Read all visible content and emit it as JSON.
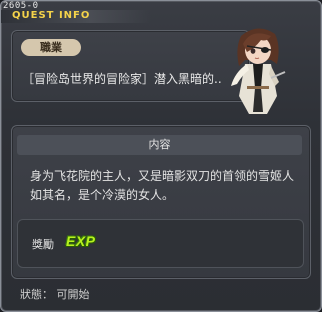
{
  "window": {
    "quest_id": "2605-0",
    "title": "QUEST INFO"
  },
  "job": {
    "tag": "職業",
    "description": "［冒险岛世界的冒险家］潜入黑暗的.."
  },
  "content": {
    "header": "内容",
    "text": "身为飞花院的主人，又是暗影双刀的首领的雪姬人如其名，是个冷漠的女人。"
  },
  "reward": {
    "label": "獎勵",
    "exp_icon_text": "EXP"
  },
  "status": {
    "text": "狀態： 可開始"
  },
  "colors": {
    "title": "#f5d34a",
    "exp": "#b8f21e",
    "job_tag_bg": "#d5c7ad"
  }
}
